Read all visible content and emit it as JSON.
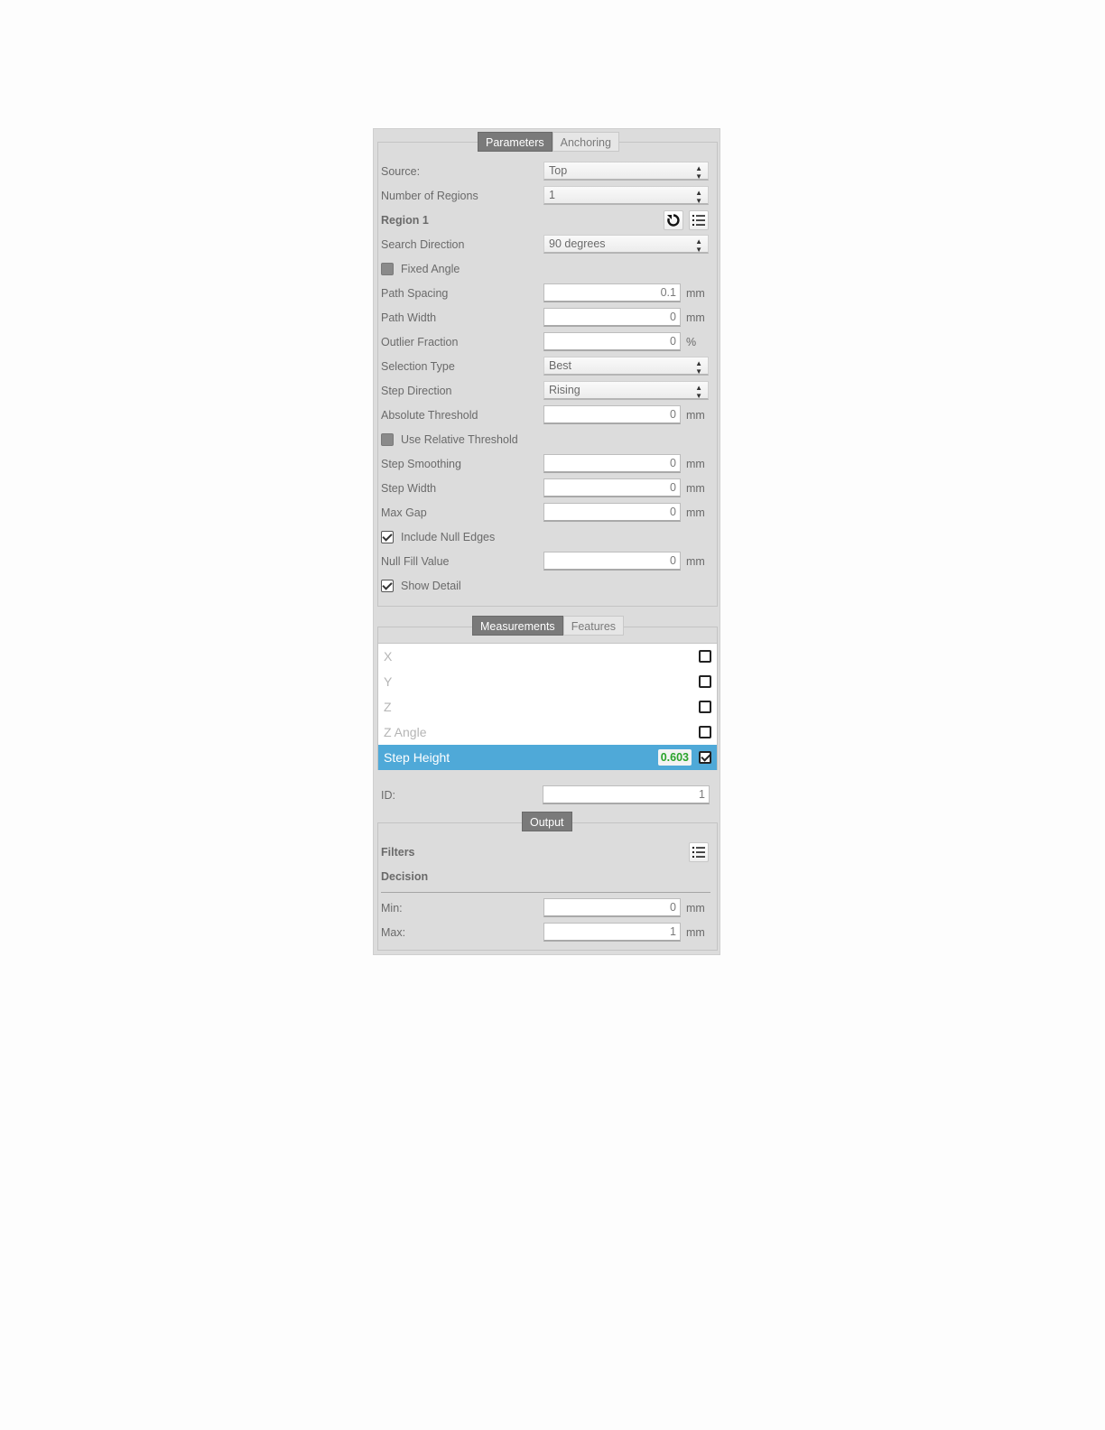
{
  "tabs_top": [
    "Parameters",
    "Anchoring"
  ],
  "tabs_meas": [
    "Measurements",
    "Features"
  ],
  "output_tab": "Output",
  "params": {
    "source": {
      "label": "Source:",
      "value": "Top"
    },
    "num_regions": {
      "label": "Number of Regions",
      "value": "1"
    },
    "region": {
      "label": "Region 1"
    },
    "search_direction": {
      "label": "Search Direction",
      "value": "90 degrees"
    },
    "fixed_angle": {
      "label": "Fixed Angle",
      "checked": false
    },
    "path_spacing": {
      "label": "Path Spacing",
      "value": "0.1",
      "unit": "mm"
    },
    "path_width": {
      "label": "Path Width",
      "value": "0",
      "unit": "mm"
    },
    "outlier_fraction": {
      "label": "Outlier Fraction",
      "value": "0",
      "unit": "%"
    },
    "selection_type": {
      "label": "Selection Type",
      "value": "Best"
    },
    "step_direction": {
      "label": "Step Direction",
      "value": "Rising"
    },
    "absolute_threshold": {
      "label": "Absolute Threshold",
      "value": "0",
      "unit": "mm"
    },
    "use_relative_threshold": {
      "label": "Use Relative Threshold",
      "checked": false
    },
    "step_smoothing": {
      "label": "Step Smoothing",
      "value": "0",
      "unit": "mm"
    },
    "step_width": {
      "label": "Step Width",
      "value": "0",
      "unit": "mm"
    },
    "max_gap": {
      "label": "Max Gap",
      "value": "0",
      "unit": "mm"
    },
    "include_null_edges": {
      "label": "Include Null Edges",
      "checked": true
    },
    "null_fill_value": {
      "label": "Null Fill Value",
      "value": "0",
      "unit": "mm"
    },
    "show_detail": {
      "label": "Show Detail",
      "checked": true
    }
  },
  "measurements": [
    {
      "label": "X",
      "checked": false
    },
    {
      "label": "Y",
      "checked": false
    },
    {
      "label": "Z",
      "checked": false
    },
    {
      "label": "Z Angle",
      "checked": false
    },
    {
      "label": "Step Height",
      "checked": true,
      "value": "0.603",
      "selected": true
    }
  ],
  "id": {
    "label": "ID:",
    "value": "1"
  },
  "output": {
    "filters_label": "Filters",
    "decision_label": "Decision",
    "min": {
      "label": "Min:",
      "value": "0",
      "unit": "mm"
    },
    "max": {
      "label": "Max:",
      "value": "1",
      "unit": "mm"
    }
  },
  "colors": {
    "selected_row": "#4fa9d8",
    "value_text": "#2aa32a",
    "active_tab": "#7a7a7a"
  }
}
